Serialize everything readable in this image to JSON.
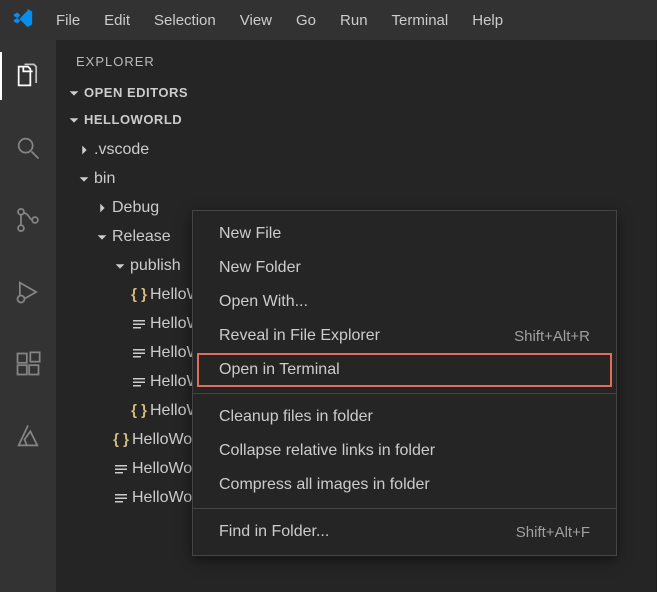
{
  "titlebar": {
    "menus": [
      "File",
      "Edit",
      "Selection",
      "View",
      "Go",
      "Run",
      "Terminal",
      "Help"
    ]
  },
  "sidebar": {
    "title": "EXPLORER",
    "sections": {
      "openEditors": "OPEN EDITORS",
      "workspace": "HELLOWORLD"
    },
    "tree": [
      {
        "type": "folder",
        "label": ".vscode",
        "expanded": false,
        "depth": 0
      },
      {
        "type": "folder",
        "label": "bin",
        "expanded": true,
        "depth": 0
      },
      {
        "type": "folder",
        "label": "Debug",
        "expanded": false,
        "depth": 1
      },
      {
        "type": "folder",
        "label": "Release",
        "expanded": true,
        "depth": 1
      },
      {
        "type": "folder",
        "label": "publish",
        "expanded": true,
        "depth": 2
      },
      {
        "type": "file",
        "label": "HelloWorld.deps.json",
        "icon": "json",
        "depth": 3
      },
      {
        "type": "file",
        "label": "HelloWorld.dll",
        "icon": "text",
        "depth": 3
      },
      {
        "type": "file",
        "label": "HelloWorld.exe",
        "icon": "text",
        "depth": 3
      },
      {
        "type": "file",
        "label": "HelloWorld.pdb",
        "icon": "text",
        "depth": 3
      },
      {
        "type": "file",
        "label": "HelloWorld.runtimeconfig.json",
        "icon": "json",
        "depth": 3
      },
      {
        "type": "file",
        "label": "HelloWorld.deps.json",
        "icon": "json",
        "depth": 2
      },
      {
        "type": "file",
        "label": "HelloWorld.dll",
        "icon": "text",
        "depth": 2
      },
      {
        "type": "file",
        "label": "HelloWorld.exe",
        "icon": "text",
        "depth": 2
      }
    ]
  },
  "contextMenu": {
    "groups": [
      [
        {
          "label": "New File",
          "shortcut": ""
        },
        {
          "label": "New Folder",
          "shortcut": ""
        },
        {
          "label": "Open With...",
          "shortcut": ""
        },
        {
          "label": "Reveal in File Explorer",
          "shortcut": "Shift+Alt+R"
        },
        {
          "label": "Open in Terminal",
          "shortcut": "",
          "highlighted": true
        }
      ],
      [
        {
          "label": "Cleanup files in folder",
          "shortcut": ""
        },
        {
          "label": "Collapse relative links in folder",
          "shortcut": ""
        },
        {
          "label": "Compress all images in folder",
          "shortcut": ""
        }
      ],
      [
        {
          "label": "Find in Folder...",
          "shortcut": "Shift+Alt+F"
        }
      ]
    ]
  }
}
